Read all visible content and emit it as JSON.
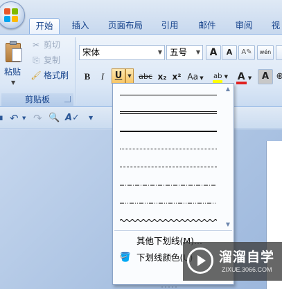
{
  "tabs": [
    {
      "label": "开始",
      "active": true
    },
    {
      "label": "插入"
    },
    {
      "label": "页面布局"
    },
    {
      "label": "引用"
    },
    {
      "label": "邮件"
    },
    {
      "label": "审阅"
    },
    {
      "label": "视"
    }
  ],
  "clipboard": {
    "paste_label": "粘贴",
    "cut_label": "剪切",
    "copy_label": "复制",
    "format_painter_label": "格式刷",
    "group_label": "剪贴板"
  },
  "font": {
    "font_name": "宋体",
    "font_size": "五号",
    "grow_label": "A",
    "shrink_label": "A",
    "bold_label": "B",
    "italic_label": "I",
    "underline_label": "U",
    "strike_label": "abc",
    "subscript_label": "x₂",
    "superscript_label": "x²",
    "change_case_label": "Aa",
    "font_color_label": "A",
    "char_shading_label": "A",
    "highlight_label": "ab",
    "phonetic_label": "wén",
    "colors": {
      "font_color": "#e02020",
      "highlight": "#ffff00"
    }
  },
  "underline_menu": {
    "styles": [
      "single",
      "double",
      "thick",
      "dotted",
      "dashed",
      "dash-dot",
      "dash-dot-dot",
      "wave"
    ],
    "more_label": "其他下划线(M)...",
    "color_label": "下划线颜色(U)"
  },
  "quick_access": {
    "items": [
      "save-icon",
      "undo-icon",
      "redo-icon",
      "print-preview-icon",
      "spelling-icon",
      "customize-icon"
    ]
  },
  "watermark": {
    "title": "溜溜自学",
    "subtitle": "ZIXUE.3066.COM"
  }
}
